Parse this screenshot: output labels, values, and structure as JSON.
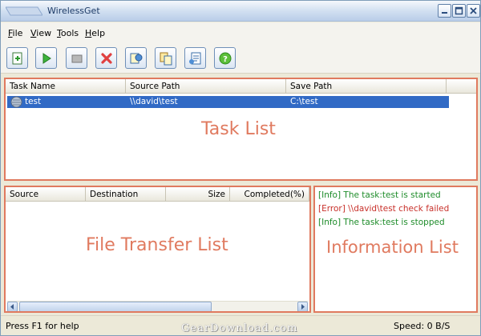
{
  "window": {
    "title": "WirelessGet"
  },
  "menu": [
    {
      "label": "File",
      "key": "F",
      "rest": "ile"
    },
    {
      "label": "View",
      "key": "V",
      "rest": "iew"
    },
    {
      "label": "Tools",
      "key": "T",
      "rest": "ools"
    },
    {
      "label": "Help",
      "key": "H",
      "rest": "elp"
    }
  ],
  "toolbar": {
    "buttons": [
      {
        "icon": "new-task-icon"
      },
      {
        "icon": "start-icon"
      },
      {
        "icon": "stop-icon"
      },
      {
        "icon": "delete-icon"
      },
      {
        "icon": "properties-icon"
      },
      {
        "icon": "copy-icon"
      },
      {
        "icon": "options-icon"
      },
      {
        "icon": "help-icon"
      }
    ]
  },
  "task_list": {
    "overlay_label": "Task List",
    "columns": [
      "Task Name",
      "Source Path",
      "Save Path"
    ],
    "rows": [
      {
        "name": "test",
        "source": "\\\\david\\test",
        "save": "C:\\test",
        "selected": true
      }
    ]
  },
  "file_transfer": {
    "overlay_label": "File Transfer List",
    "columns": [
      "Source",
      "Destination",
      "Size",
      "Completed(%)"
    ]
  },
  "info_list": {
    "overlay_label": "Information List",
    "lines": [
      {
        "text": "[Info] The task:test is started",
        "level": "info"
      },
      {
        "text": "[Error] \\\\david\\test check failed",
        "level": "error"
      },
      {
        "text": "[Info] The task:test is stopped",
        "level": "info"
      }
    ]
  },
  "status": {
    "help": "Press F1 for help",
    "speed": "Speed: 0 B/S",
    "brand": "GearDownload.com"
  },
  "colors": {
    "annotation": "#e07a5f",
    "selection": "#316ac5",
    "info": "#1e8c2a",
    "error": "#c8302a"
  }
}
